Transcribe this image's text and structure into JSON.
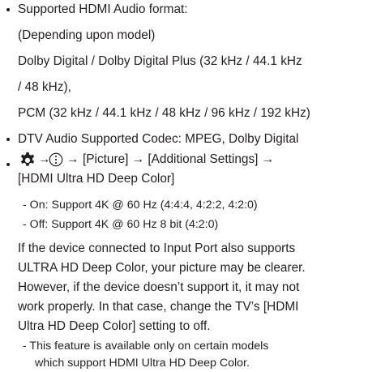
{
  "document": {
    "bullets": [
      {
        "lines": [
          "Supported HDMI Audio format:",
          "(Depending upon model)",
          "Dolby Digital / Dolby Digital Plus (32 kHz / 44.1 kHz",
          "/ 48 kHz),",
          "PCM (32 kHz / 44.1 kHz / 48 kHz / 96 kHz / 192 kHz)"
        ]
      },
      {
        "lines": [
          "DTV Audio Supported Codec: MPEG, Dolby Digital"
        ]
      }
    ],
    "settings_bullet": {
      "gear_icon": "gear-icon",
      "more_icon": "vertical-dots-icon",
      "arrow": "→",
      "path_rest": "[Picture] → [Additional Settings] →",
      "path_line2": "[HDMI Ultra HD Deep Color]",
      "options": [
        "- On: Support 4K @ 60 Hz (4:4:4, 4:2:2, 4:2:0)",
        "- Off: Support 4K @ 60 Hz 8 bit (4:2:0)"
      ],
      "paragraph": [
        "If the device connected to Input Port also supports",
        "ULTRA HD Deep Color, your picture may be clearer.",
        "However, if the device doesn’t support it, it may not",
        "work properly. In that case, change the TV’s [HDMI",
        "Ultra HD Deep Color] setting to off."
      ],
      "note": [
        "- This feature is available only on certain models",
        "which support HDMI Ultra HD Deep Color."
      ]
    }
  }
}
